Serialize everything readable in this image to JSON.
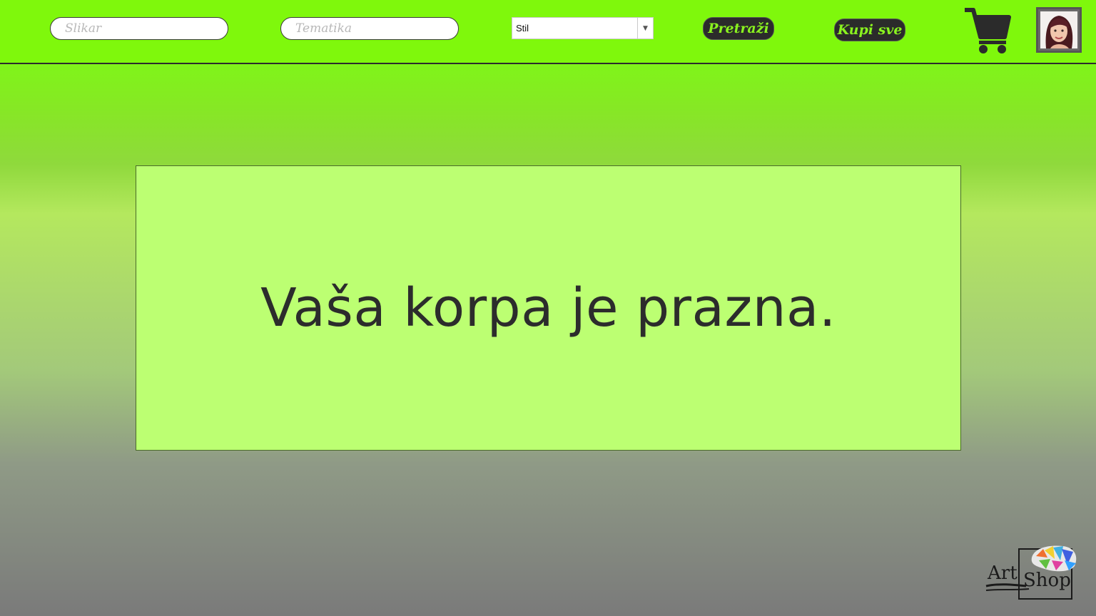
{
  "header": {
    "painter_input": {
      "placeholder": "Slikar",
      "value": ""
    },
    "theme_input": {
      "placeholder": "Tematika",
      "value": ""
    },
    "style_select": {
      "selected": "Stil"
    },
    "search_button": "Pretraži",
    "buy_all_button": "Kupi sve",
    "cart_icon": "shopping-cart-icon",
    "avatar": "user-avatar"
  },
  "main": {
    "empty_message": "Vaša korpa je prazna."
  },
  "logo": {
    "line1": "Art",
    "line2": "Shop"
  },
  "colors": {
    "topbar": "#7ff80c",
    "panel": "#bcff72",
    "button_bg": "#2b2b2b",
    "button_text": "#8af21f",
    "text_dark": "#2c2c2c"
  }
}
